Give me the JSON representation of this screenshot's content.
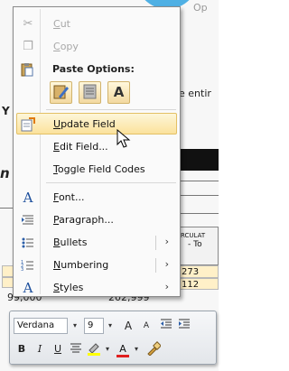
{
  "document": {
    "fragments": {
      "top_partial": "Op",
      "entire_partial": "e entir",
      "left_letter": "Y",
      "bold_n": "n",
      "table_header_line1": "RCULAT",
      "table_header_line2": "- To",
      "bottom_num": "99,000",
      "bottom_num2": "202,999",
      "row1_val": "273",
      "row2_val": "112"
    }
  },
  "context_menu": {
    "items": [
      {
        "label": "Cut",
        "icon": "scissors-icon",
        "enabled": false
      },
      {
        "label": "Copy",
        "icon": "copy-icon",
        "enabled": false
      },
      {
        "label": "Paste Options:",
        "icon": "clipboard-icon",
        "enabled": true
      },
      {
        "label": "Update Field",
        "icon": "update-field-icon",
        "enabled": true,
        "highlighted": true
      },
      {
        "label": "Edit Field...",
        "enabled": true
      },
      {
        "label": "Toggle Field Codes",
        "enabled": true
      },
      {
        "label": "Font...",
        "icon": "font-icon",
        "enabled": true
      },
      {
        "label": "Paragraph...",
        "icon": "paragraph-icon",
        "enabled": true
      },
      {
        "label": "Bullets",
        "icon": "bullets-icon",
        "enabled": true,
        "submenu": true
      },
      {
        "label": "Numbering",
        "icon": "numbering-icon",
        "enabled": true,
        "submenu": true
      },
      {
        "label": "Styles",
        "icon": "styles-icon",
        "enabled": true,
        "submenu": true
      }
    ],
    "paste_options": [
      "keep-source-formatting",
      "merge-formatting",
      "keep-text-only"
    ],
    "paste_text_only_glyph": "A"
  },
  "mini_toolbar": {
    "font_name": "Verdana",
    "font_size": "9",
    "grow_font": "A",
    "shrink_font": "A",
    "bold": "B",
    "italic": "I",
    "underline": "U",
    "font_color": "A"
  },
  "colors": {
    "highlight": "#fbe29c",
    "accent_blue": "#2b5ea8",
    "disabled_text": "#a8a8a8"
  }
}
